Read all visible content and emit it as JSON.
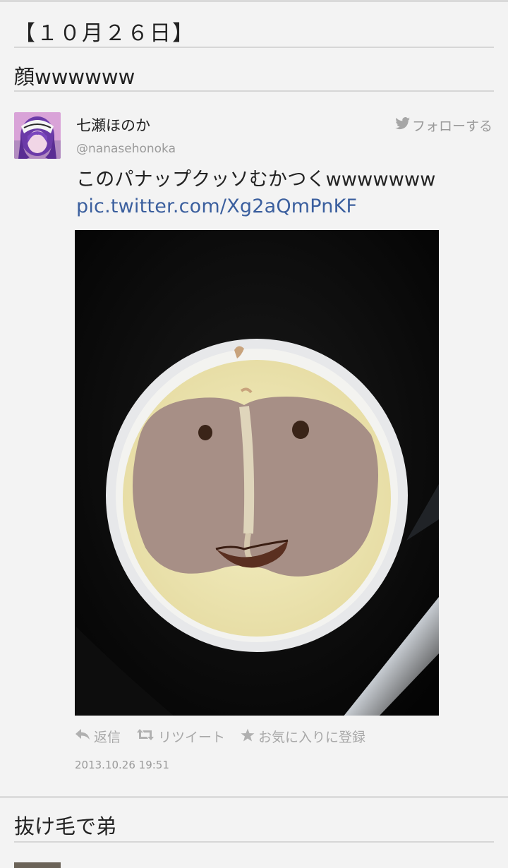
{
  "date_heading": "【１０月２６日】",
  "sections": [
    {
      "title": "顔wwwwww"
    },
    {
      "title": "抜け毛で弟"
    }
  ],
  "tweet": {
    "author_name": "七瀬ほのか",
    "author_handle": "@nanasehonoka",
    "follow_label": "フォローする",
    "text": "このパナップクッソむかつくwwwwwww ",
    "link_text": "pic.twitter.com/Xg2aQmPnKF",
    "actions": {
      "reply": "返信",
      "retweet": "リツイート",
      "favorite": "お気に入りに登録"
    },
    "timestamp": "2013.10.26 19:51"
  },
  "colors": {
    "background": "#f3f3f3",
    "link": "#3b5f9e",
    "muted": "#9a9a9a"
  },
  "icons": [
    "twitter-bird-icon",
    "reply-icon",
    "retweet-icon",
    "star-icon"
  ]
}
